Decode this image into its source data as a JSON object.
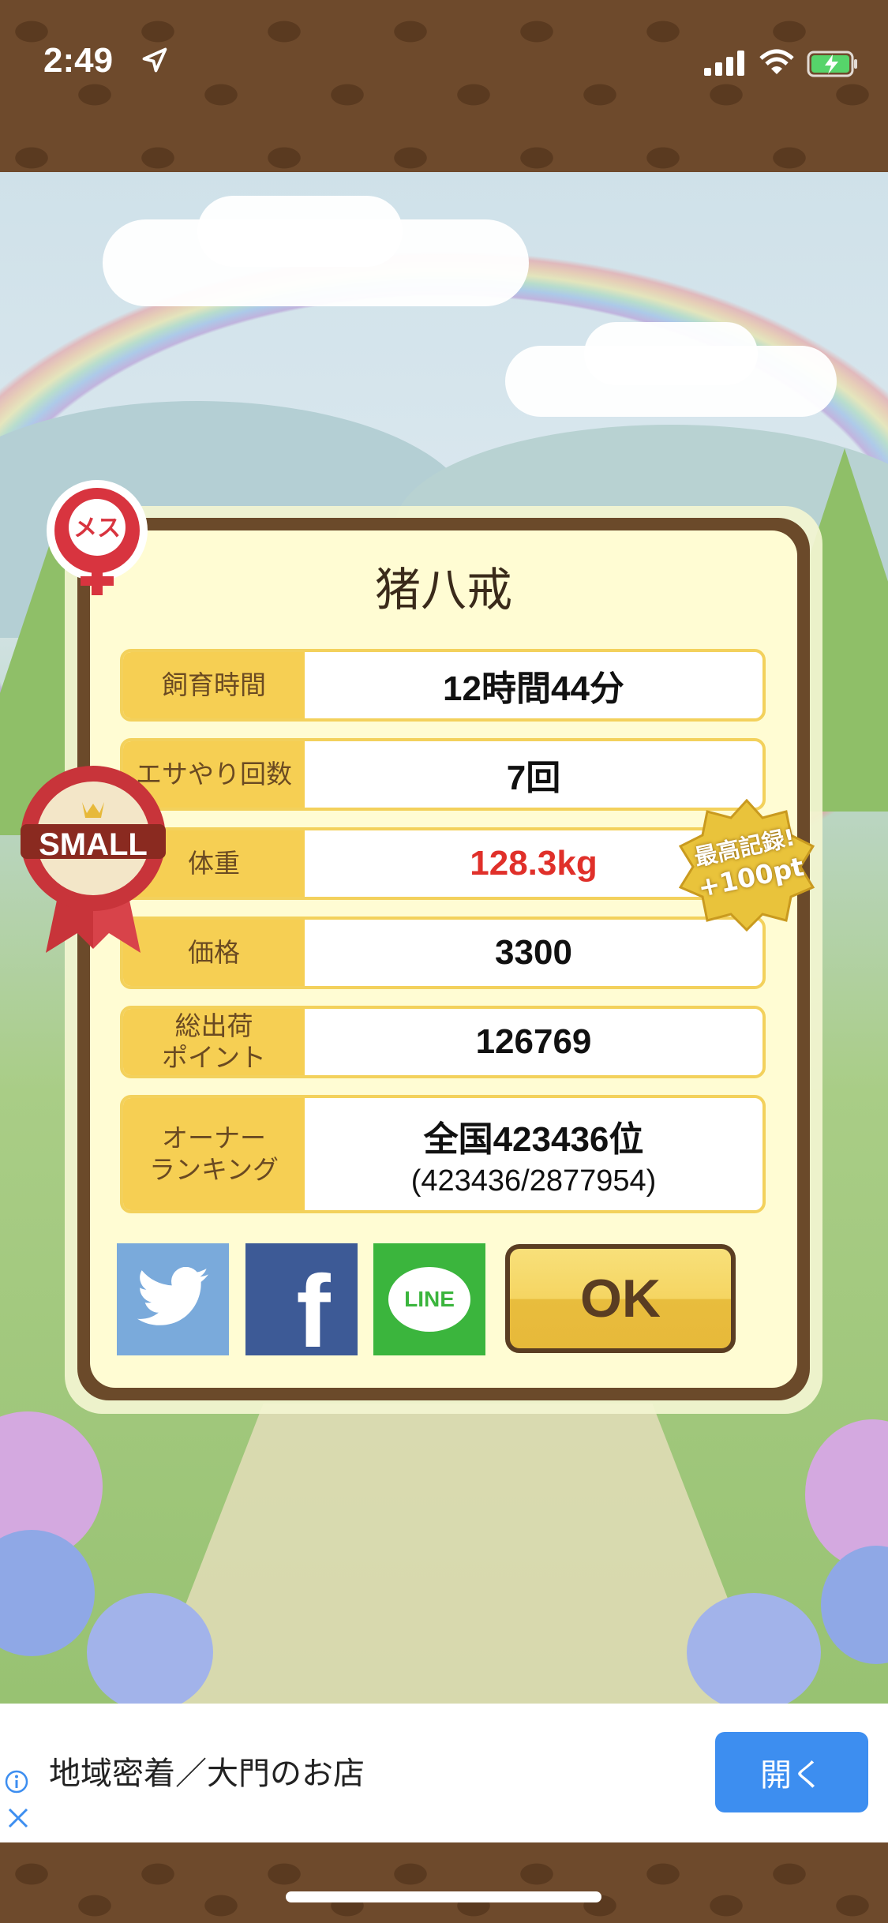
{
  "status_bar": {
    "time": "2:49"
  },
  "dialog": {
    "title": "猪八戒",
    "rows": [
      {
        "label": "飼育時間",
        "value": "12時間44分"
      },
      {
        "label": "エサやり回数",
        "value": "7回"
      },
      {
        "label": "体重",
        "value": "128.3kg"
      },
      {
        "label": "価格",
        "value": "3300"
      },
      {
        "label_line1": "総出荷",
        "label_line2": "ポイント",
        "value": "126769"
      },
      {
        "label_line1": "オーナー",
        "label_line2": "ランキング",
        "value": "全国423436位",
        "sub_value": "(423436/2877954)"
      }
    ],
    "ok_label": "OK"
  },
  "badges": {
    "gender": "メス",
    "size": "SMALL",
    "record_line1": "最高記録!",
    "record_line2": "+100pt"
  },
  "share": {
    "twitter": "twitter",
    "facebook": "f",
    "line": "LINE"
  },
  "ad": {
    "text": "地域密着／大門のお店",
    "button": "開く"
  },
  "colors": {
    "accent_yellow": "#f6cf53",
    "panel_border": "#6b4a2a",
    "red_value": "#e0302a",
    "ad_button": "#3d8ef0"
  }
}
